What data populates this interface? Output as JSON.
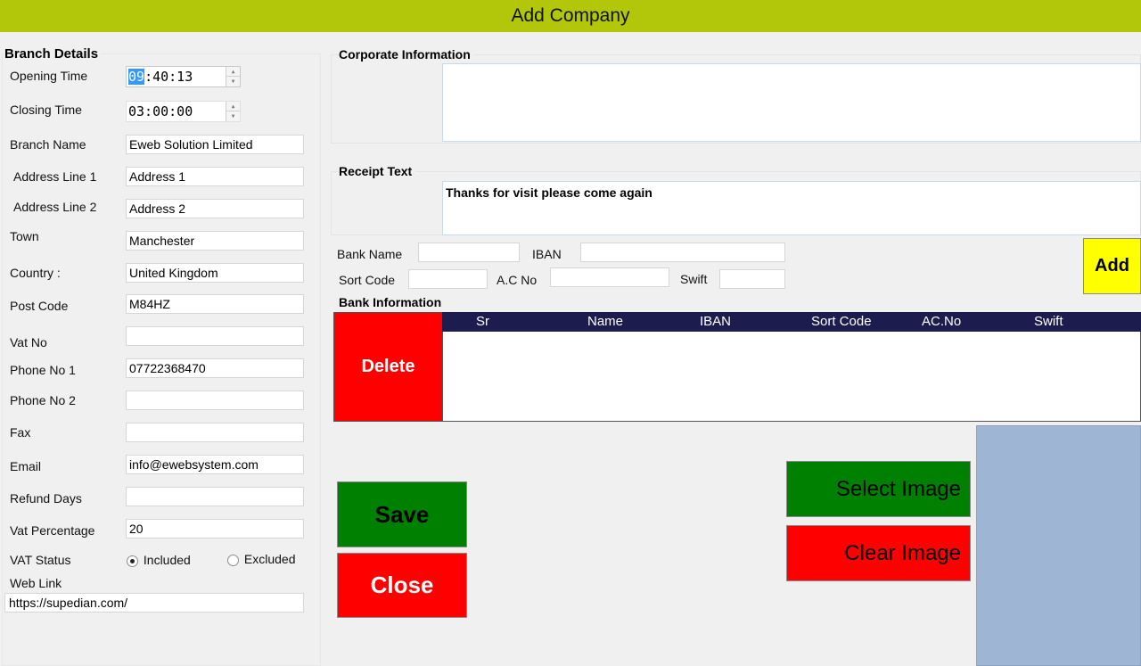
{
  "window": {
    "title": "Add Company"
  },
  "branch": {
    "group_title": "Branch Details",
    "opening_time": {
      "label": "Opening Time",
      "hour": "09",
      "rest": ":40:13"
    },
    "closing_time": {
      "label": "Closing Time",
      "value": "03:00:00"
    },
    "branch_name": {
      "label": "Branch Name",
      "value": "Eweb Solution Limited"
    },
    "address1": {
      "label": "Address Line 1",
      "value": "Address 1"
    },
    "address2": {
      "label": "Address Line 2",
      "value": "Address 2"
    },
    "town": {
      "label": "Town",
      "value": "Manchester"
    },
    "country": {
      "label": "Country :",
      "value": "United Kingdom"
    },
    "post_code": {
      "label": "Post Code",
      "value": "M84HZ"
    },
    "vat_no": {
      "label": "Vat No",
      "value": ""
    },
    "phone1": {
      "label": "Phone No 1",
      "value": "07722368470"
    },
    "phone2": {
      "label": "Phone No 2",
      "value": ""
    },
    "fax": {
      "label": "Fax",
      "value": ""
    },
    "email": {
      "label": "Email",
      "value": "info@ewebsystem.com"
    },
    "refund_days": {
      "label": "Refund Days",
      "value": ""
    },
    "vat_percentage": {
      "label": "Vat Percentage",
      "value": "20"
    },
    "vat_status": {
      "label": "VAT Status",
      "included": "Included",
      "excluded": "Excluded",
      "selected": "Included"
    },
    "web_link": {
      "label": "Web Link",
      "value": "https://supedian.com/"
    }
  },
  "corporate": {
    "title": "Corporate Information",
    "value": ""
  },
  "receipt": {
    "title": "Receipt Text",
    "value": "Thanks for visit please come again"
  },
  "bank_form": {
    "bank_name_label": "Bank Name",
    "iban_label": "IBAN",
    "sort_code_label": "Sort Code",
    "ac_no_label": "A.C No",
    "swift_label": "Swift",
    "add_label": "Add"
  },
  "bank_info": {
    "title": "Bank Information",
    "delete_label": "Delete",
    "columns": [
      "Sr",
      "Name",
      "IBAN",
      "Sort Code",
      "AC.No",
      "Swift"
    ],
    "rows": []
  },
  "actions": {
    "save": "Save",
    "close": "Close",
    "select_image": "Select Image",
    "clear_image": "Clear Image"
  },
  "colors": {
    "title_bar": "#b3c70a",
    "grid_header": "#1c1c4e",
    "green_button": "#008000",
    "red_button": "#ff0000",
    "add_button": "#ffff00",
    "image_box": "#9fb5d4"
  }
}
